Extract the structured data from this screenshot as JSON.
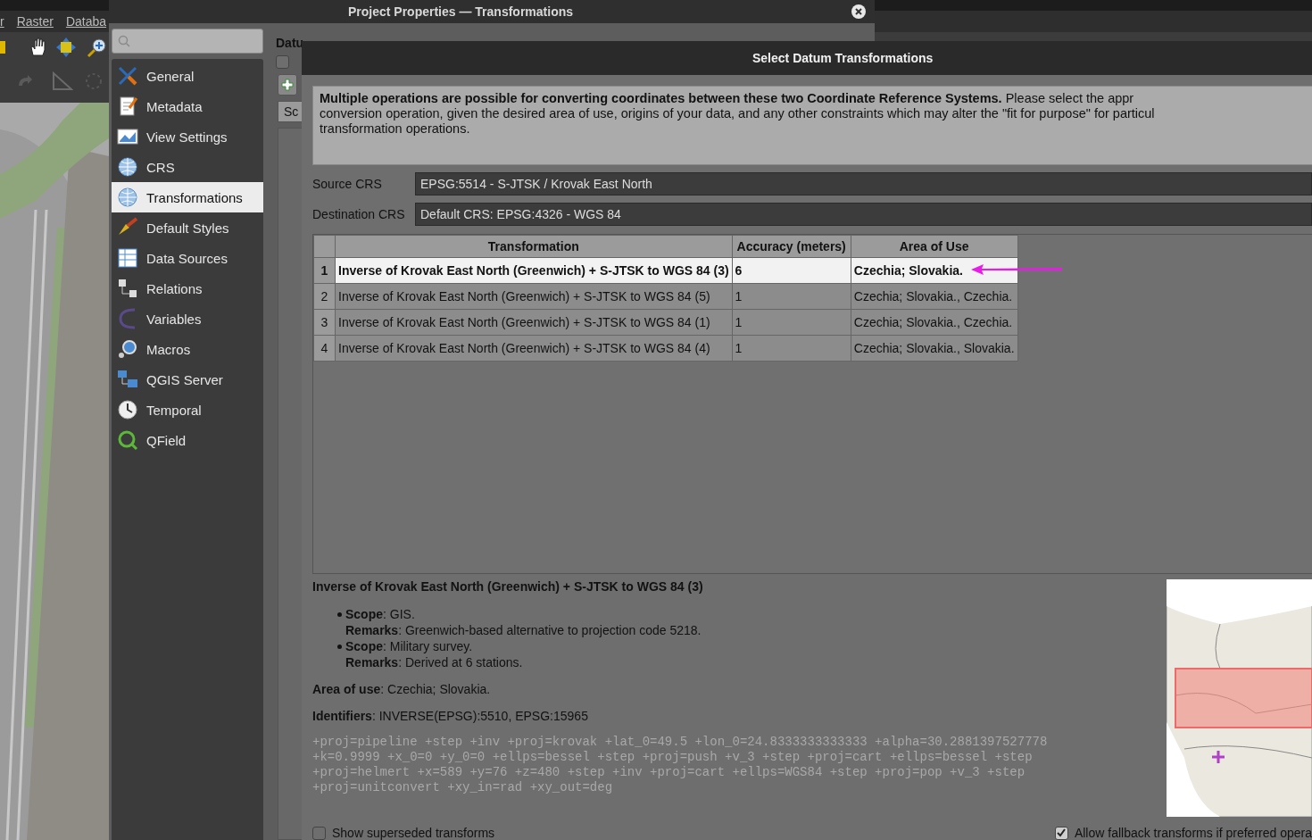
{
  "main_window": {
    "menu_items": [
      "r",
      "Raster",
      "Databa"
    ]
  },
  "properties_dialog": {
    "title": "Project Properties — Transformations",
    "sidebar": {
      "items": [
        {
          "label": "General",
          "selected": false
        },
        {
          "label": "Metadata",
          "selected": false
        },
        {
          "label": "View Settings",
          "selected": false
        },
        {
          "label": "CRS",
          "selected": false
        },
        {
          "label": "Transformations",
          "selected": true
        },
        {
          "label": "Default Styles",
          "selected": false
        },
        {
          "label": "Data Sources",
          "selected": false
        },
        {
          "label": "Relations",
          "selected": false
        },
        {
          "label": "Variables",
          "selected": false
        },
        {
          "label": "Macros",
          "selected": false
        },
        {
          "label": "QGIS Server",
          "selected": false
        },
        {
          "label": "Temporal",
          "selected": false
        },
        {
          "label": "QField",
          "selected": false
        }
      ]
    },
    "panel": {
      "heading": "Datu",
      "checkbox": {
        "checked": false
      },
      "tab": "Sc"
    }
  },
  "datum_dialog": {
    "title": "Select Datum Transformations",
    "intro_lines": [
      "**Multiple operations are possible for converting coordinates between these two Coordinate Reference Systems.** Please select the appr",
      "conversion operation, given the desired area of use, origins of your data, and any other constraints which may alter the \"fit for purpose\" for particul",
      "transformation operations."
    ],
    "source_crs": {
      "label": "Source CRS",
      "value": "EPSG:5514 - S-JTSK / Krovak East North"
    },
    "destination_crs": {
      "label": "Destination CRS",
      "value": "Default CRS: EPSG:4326 - WGS 84"
    },
    "table": {
      "columns": [
        "Transformation",
        "Accuracy (meters)",
        "Area of Use"
      ],
      "rows": [
        {
          "number": "1",
          "transformation": "Inverse of Krovak East North (Greenwich) + S-JTSK to WGS 84 (3)",
          "accuracy": "6",
          "area": "Czechia; Slovakia.",
          "selected": true
        },
        {
          "number": "2",
          "transformation": "Inverse of Krovak East North (Greenwich) + S-JTSK to WGS 84 (5)",
          "accuracy": "1",
          "area": "Czechia; Slovakia., Czechia.",
          "selected": false
        },
        {
          "number": "3",
          "transformation": "Inverse of Krovak East North (Greenwich) + S-JTSK to WGS 84 (1)",
          "accuracy": "1",
          "area": "Czechia; Slovakia., Czechia.",
          "selected": false
        },
        {
          "number": "4",
          "transformation": "Inverse of Krovak East North (Greenwich) + S-JTSK to WGS 84 (4)",
          "accuracy": "1",
          "area": "Czechia; Slovakia., Slovakia.",
          "selected": false
        }
      ]
    },
    "details": {
      "title": "Inverse of Krovak East North (Greenwich) + S-JTSK to WGS 84 (3)",
      "usages": [
        {
          "scope": "**Scope**: GIS.",
          "remarks": "**Remarks**: Greenwich-based alternative to projection code 5218."
        },
        {
          "scope": "**Scope**: Military survey.",
          "remarks": "**Remarks**: Derived at 6 stations."
        }
      ],
      "area_of_use": "**Area of use**: Czechia; Slovakia.",
      "identifiers": "**Identifiers**: INVERSE(EPSG):5510, EPSG:15965",
      "proj_lines": [
        "+proj=pipeline +step +inv +proj=krovak +lat_0=49.5 +lon_0=24.8333333333333 +alpha=30.2881397527778",
        "+k=0.9999 +x_0=0 +y_0=0 +ellps=bessel +step +proj=push +v_3 +step +proj=cart +ellps=bessel +step",
        "+proj=helmert +x=589 +y=76 +z=480 +step +inv +proj=cart +ellps=WGS84 +step +proj=pop +v_3 +step",
        "+proj=unitconvert +xy_in=rad +xy_out=deg"
      ]
    },
    "options": [
      {
        "label": "Show superseded transforms",
        "checked": false
      },
      {
        "label": "Allow fallback transforms if preferred opera",
        "checked": true
      }
    ]
  }
}
